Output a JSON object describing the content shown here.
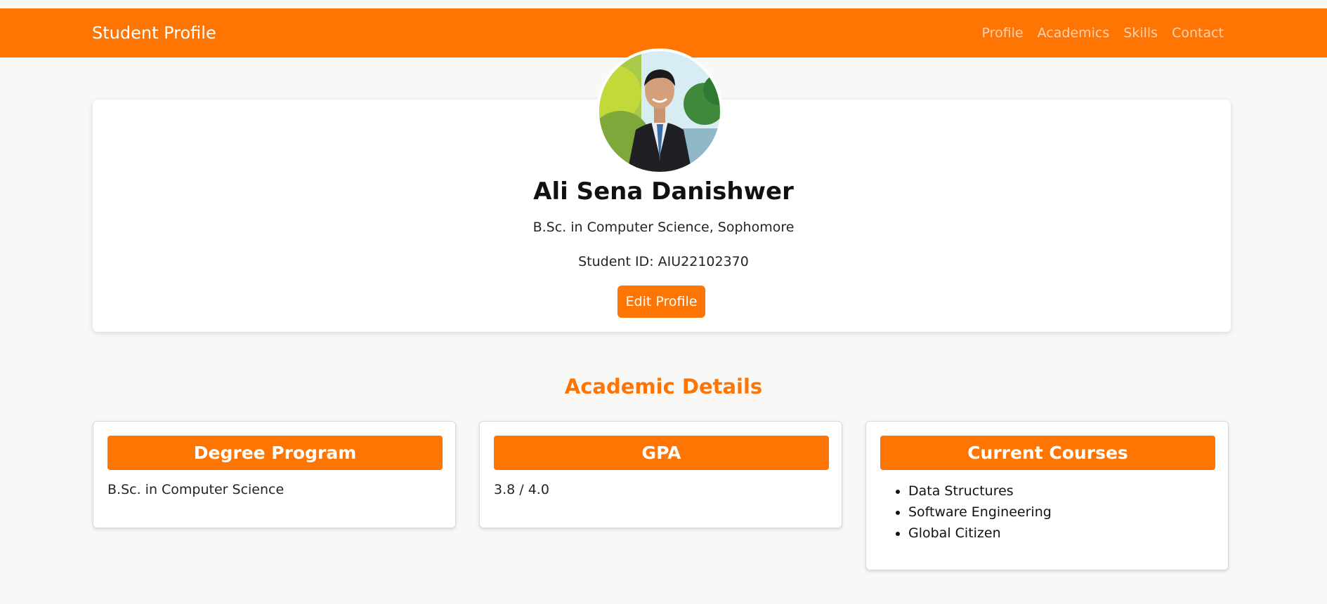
{
  "navbar": {
    "brand": "Student Profile",
    "links": [
      "Profile",
      "Academics",
      "Skills",
      "Contact"
    ]
  },
  "profile": {
    "name": "Ali Sena Danishwer",
    "degree_line": "B.Sc. in Computer Science, Sophomore",
    "student_id": "Student ID: AIU22102370",
    "edit_label": "Edit Profile"
  },
  "academics": {
    "title": "Academic Details",
    "degree": {
      "title": "Degree Program",
      "value": "B.Sc. in Computer Science"
    },
    "gpa": {
      "title": "GPA",
      "value": "3.8 / 4.0"
    },
    "courses": {
      "title": "Current Courses",
      "items": [
        "Data Structures",
        "Software Engineering",
        "Global Citizen"
      ]
    }
  },
  "colors": {
    "accent": "#ff7504",
    "background": "#f8f8f6",
    "nav_link": "#fbd3b2"
  }
}
